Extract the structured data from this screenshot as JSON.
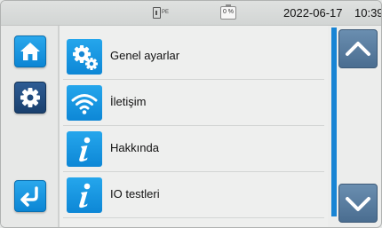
{
  "status_bar": {
    "connection_icon": "plug-pe-icon",
    "connection_label": "PE",
    "battery_icon": "battery-icon",
    "battery_percent": "0 %",
    "date": "2022-06-17",
    "time": "10:39"
  },
  "left_panel": {
    "home_icon": "home-icon",
    "settings_icon": "gear-icon",
    "back_icon": "return-arrow-icon"
  },
  "menu": {
    "items": [
      {
        "label": "Genel ayarlar",
        "icon": "gears-icon"
      },
      {
        "label": "İletişim",
        "icon": "wifi-icon"
      },
      {
        "label": "Hakkında",
        "icon": "info-icon"
      },
      {
        "label": "IO testleri",
        "icon": "info-icon"
      }
    ]
  },
  "scroll": {
    "up_icon": "chevron-up-icon",
    "down_icon": "chevron-down-icon"
  },
  "colors": {
    "accent_blue": "#1884d4",
    "dark_blue": "#1f4a7c",
    "arrow_gray": "#5a7fa3"
  }
}
